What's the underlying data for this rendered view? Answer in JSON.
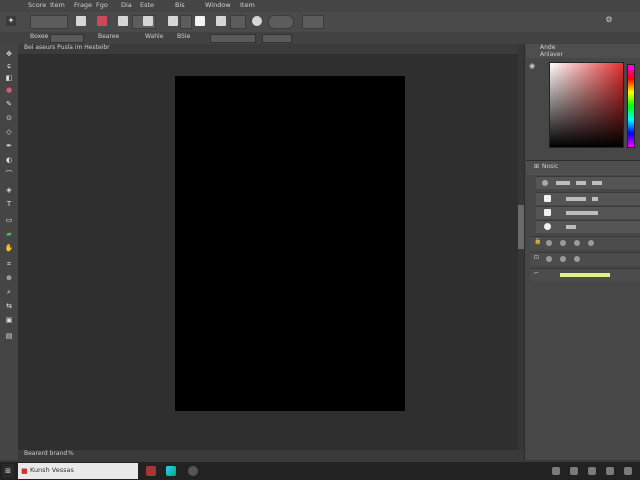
{
  "menu": {
    "items": [
      "Score",
      "Item",
      "Frage",
      "Fgo",
      "Dia",
      "Este",
      "Bis",
      "Window",
      "Item"
    ]
  },
  "options": {
    "items": [
      "Boxee",
      "Bearee",
      "Wahle",
      "BSIe"
    ]
  },
  "doc_tab": {
    "title": "Bei aseurs Pusla im Hesteibr"
  },
  "status_bar": {
    "zoom": "Bearerd brand",
    "ratio": "%"
  },
  "panels": {
    "color": {
      "tab_label": "Ande",
      "tab_sub": "Anlaver"
    },
    "layers": {
      "tab_label": "Nosic"
    }
  },
  "taskbar": {
    "app_label": "Kunsh Vessas"
  },
  "icons": [
    "search-icon",
    "brush-icon",
    "eraser-icon",
    "move-icon",
    "lasso-icon",
    "crop-icon",
    "pen-icon",
    "text-icon",
    "eyedropper-icon",
    "stamp-icon",
    "gradient-icon",
    "zoom-icon",
    "hand-icon"
  ]
}
